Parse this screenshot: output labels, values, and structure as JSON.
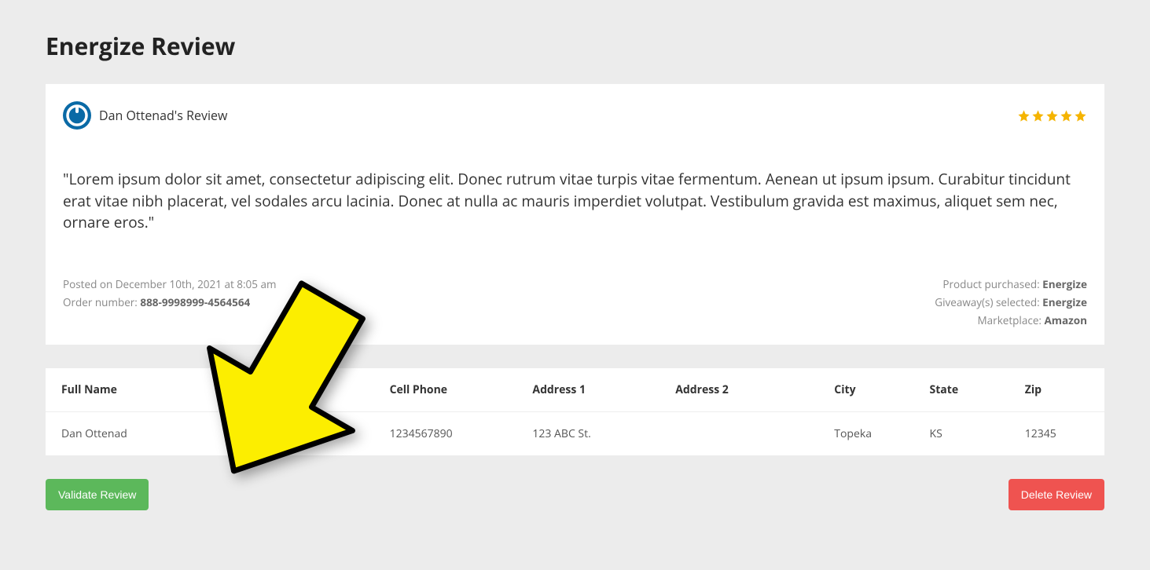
{
  "page": {
    "title": "Energize Review"
  },
  "review": {
    "reviewer_title": "Dan Ottenad's Review",
    "rating": 5,
    "body": "\"Lorem ipsum dolor sit amet, consectetur adipiscing elit. Donec rutrum vitae turpis vitae fermentum. Aenean ut ipsum ipsum. Curabitur tincidunt erat vitae nibh placerat, vel sodales arcu lacinia. Donec at nulla ac mauris imperdiet volutpat. Vestibulum gravida est maximus, aliquet sem nec, ornare eros.\"",
    "posted_prefix": "Posted on ",
    "posted_on": "December 10th, 2021 at 8:05 am",
    "order_label": "Order number: ",
    "order_number": "888-9998999-4564564",
    "product_label": "Product purchased: ",
    "product": "Energize",
    "giveaway_label": "Giveaway(s) selected: ",
    "giveaway": "Energize",
    "marketplace_label": "Marketplace: ",
    "marketplace": "Amazon"
  },
  "table": {
    "headers": {
      "full_name": "Full Name",
      "cell_phone": "Cell Phone",
      "address1": "Address 1",
      "address2": "Address 2",
      "city": "City",
      "state": "State",
      "zip": "Zip"
    },
    "row": {
      "full_name": "Dan Ottenad",
      "cell_phone": "1234567890",
      "address1": "123 ABC St.",
      "address2": "",
      "city": "Topeka",
      "state": "KS",
      "zip": "12345"
    }
  },
  "buttons": {
    "validate": "Validate Review",
    "delete": "Delete Review"
  },
  "colors": {
    "star": "#f5b400",
    "avatar": "#0a6aa6",
    "validate": "#5cb85b",
    "delete": "#ef5350",
    "arrow": "#fcee00"
  }
}
